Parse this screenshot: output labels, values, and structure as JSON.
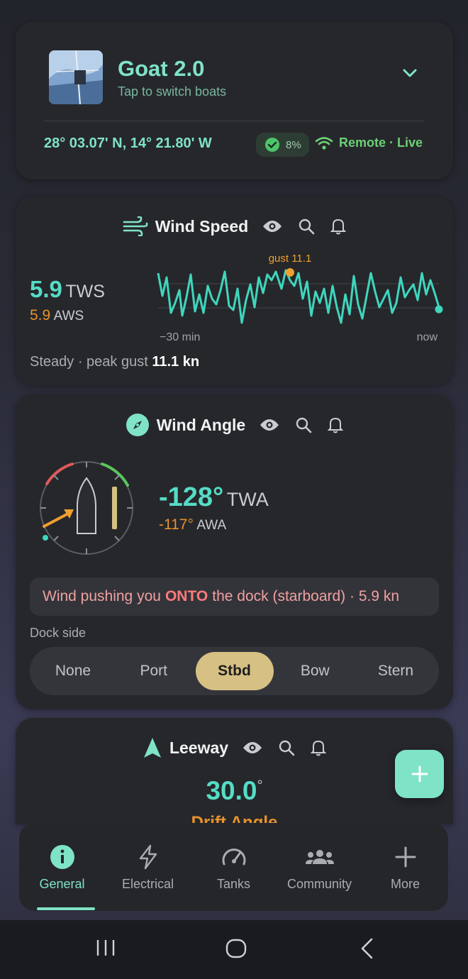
{
  "boat": {
    "name": "Goat 2.0",
    "subtitle": "Tap to switch boats",
    "coordinates": "28° 03.07' N, 14° 21.80' W",
    "battery": "8%",
    "connection": "Remote · Live"
  },
  "wind_speed": {
    "title": "Wind Speed",
    "tws_value": "5.9",
    "tws_unit": "TWS",
    "aws_value": "5.9",
    "aws_unit": "AWS",
    "gust_label": "gust 11.1",
    "axis_start": "−30 min",
    "axis_end": "now",
    "footer_prefix": "Steady · peak gust ",
    "footer_value": "11.1 kn",
    "colors": {
      "line": "#3fd6bd",
      "gust": "#f0a030"
    }
  },
  "wind_angle": {
    "title": "Wind Angle",
    "twa_value": "-128°",
    "twa_unit": "TWA",
    "awa_value": "-117°",
    "awa_unit": "AWA",
    "alert_prefix": "Wind pushing you",
    "alert_strong": "ONTO",
    "alert_suffix": "the dock (starboard) · 5.9 kn",
    "dock_label": "Dock side",
    "dock_options": [
      "None",
      "Port",
      "Stbd",
      "Bow",
      "Stern"
    ],
    "dock_selected": "Stbd"
  },
  "leeway": {
    "title": "Leeway",
    "value": "30.0",
    "unit": "°",
    "sub": "Drift Angle"
  },
  "nav": {
    "items": [
      "General",
      "Electrical",
      "Tanks",
      "Community",
      "More"
    ],
    "active": "General"
  },
  "icons": [
    "wind-icon",
    "eye-icon",
    "search-icon",
    "bell-icon",
    "compass-icon",
    "leeway-arrow-icon",
    "check-circle-icon",
    "wifi-icon",
    "chevron-down-icon",
    "plus-icon",
    "info-icon",
    "bolt-icon",
    "gauge-icon",
    "people-icon"
  ],
  "accent": "#7fe3c6"
}
